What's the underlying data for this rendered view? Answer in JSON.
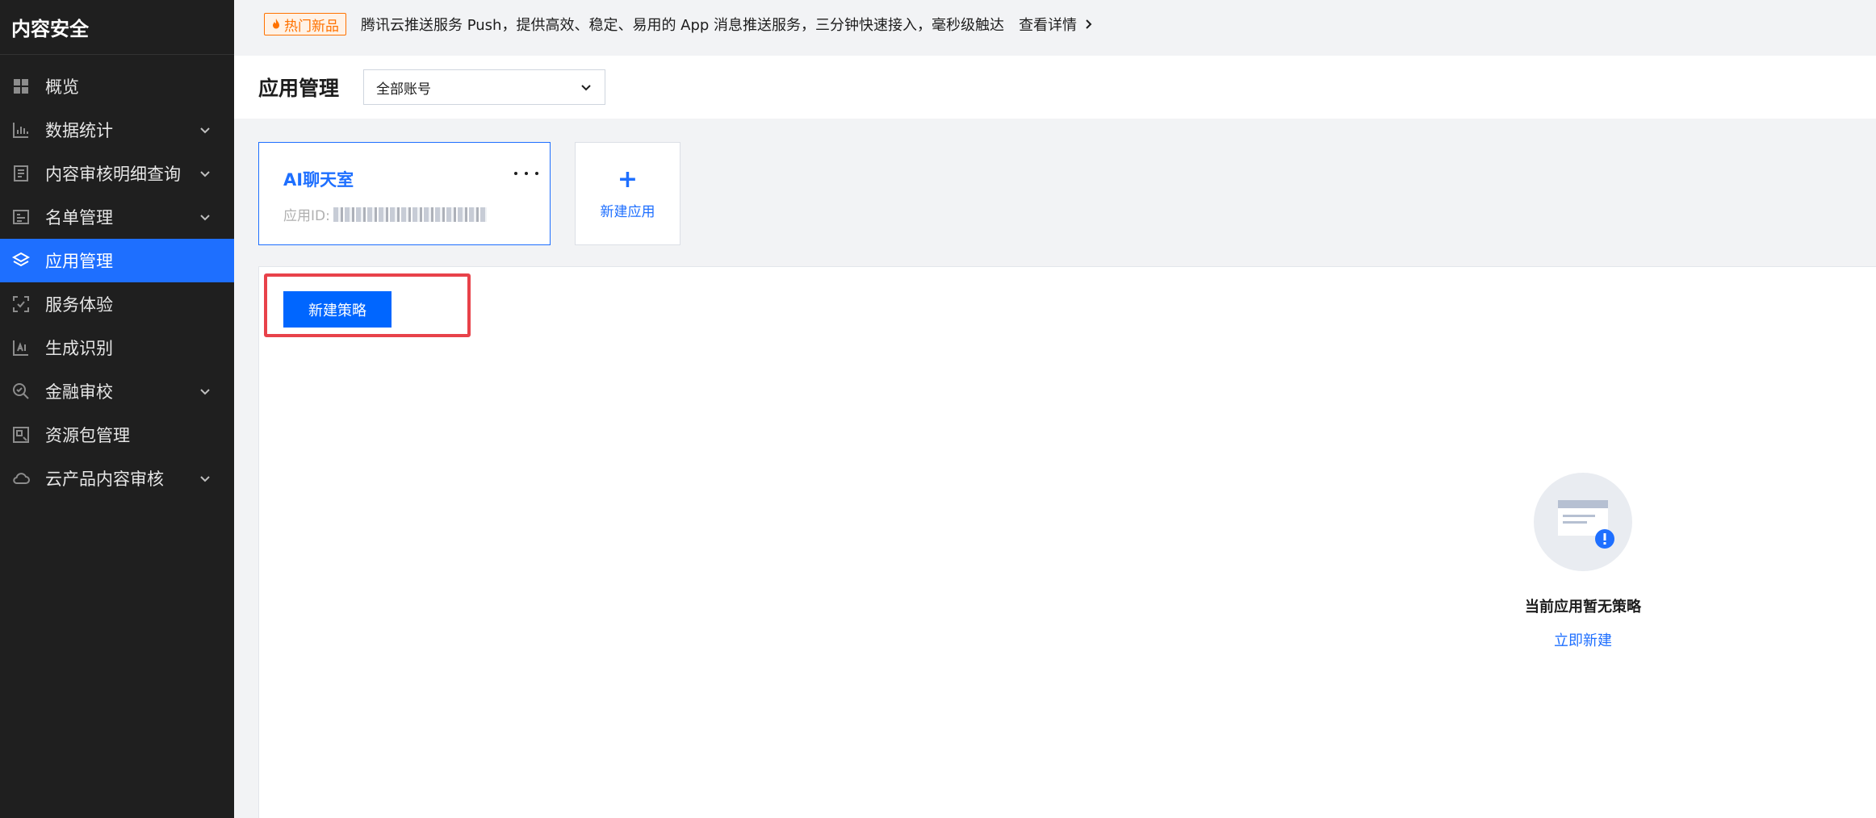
{
  "sidebar": {
    "brand": "内容安全",
    "items": [
      {
        "label": "概览",
        "icon": "dashboard-icon",
        "expandable": false,
        "active": false
      },
      {
        "label": "数据统计",
        "icon": "bar-chart-icon",
        "expandable": true,
        "active": false
      },
      {
        "label": "内容审核明细查询",
        "icon": "document-icon",
        "expandable": true,
        "active": false
      },
      {
        "label": "名单管理",
        "icon": "list-card-icon",
        "expandable": true,
        "active": false
      },
      {
        "label": "应用管理",
        "icon": "layers-icon",
        "expandable": false,
        "active": true
      },
      {
        "label": "服务体验",
        "icon": "scan-check-icon",
        "expandable": false,
        "active": false
      },
      {
        "label": "生成识别",
        "icon": "ai-detect-icon",
        "expandable": false,
        "active": false
      },
      {
        "label": "金融审校",
        "icon": "search-check-icon",
        "expandable": true,
        "active": false
      },
      {
        "label": "资源包管理",
        "icon": "package-icon",
        "expandable": false,
        "active": false
      },
      {
        "label": "云产品内容审核",
        "icon": "cloud-icon",
        "expandable": true,
        "active": false
      }
    ]
  },
  "topbar": {
    "badge": "热门新品",
    "text": "腾讯云推送服务 Push，提供高效、稳定、易用的 App 消息推送服务，三分钟快速接入，毫秒级触达",
    "link": "查看详情"
  },
  "header": {
    "title": "应用管理",
    "account_select": "全部账号"
  },
  "app_card": {
    "name": "AI聊天室",
    "id_label": "应用ID:",
    "id_value": "2013208381082740"
  },
  "new_app": {
    "plus": "+",
    "label": "新建应用"
  },
  "strategy": {
    "new_button": "新建策略",
    "empty_title": "当前应用暂无策略",
    "empty_link": "立即新建"
  },
  "colors": {
    "sidebar_bg": "#1f1f1f",
    "active_bg": "#1e6fff",
    "primary": "#0066ff",
    "highlight": "#e8424a",
    "badge": "#ff7200"
  }
}
